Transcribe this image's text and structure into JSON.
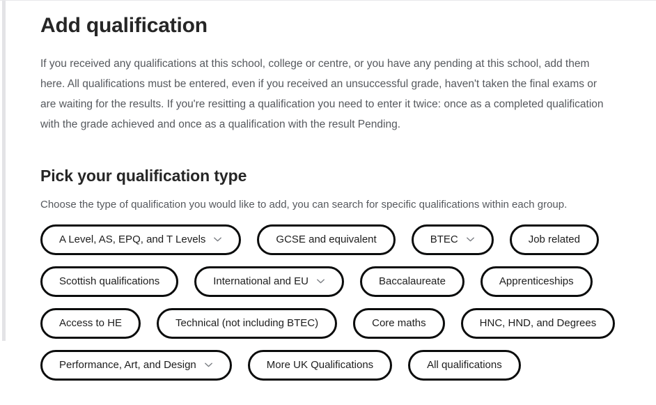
{
  "page": {
    "title": "Add qualification",
    "intro": "If you received any qualifications at this school, college or centre, or you have any pending at this school, add them here. All qualifications must be entered, even if you received an unsuccessful grade, haven't taken the final exams or are waiting for the results. If you're resitting a qualification you need to enter it twice: once as a completed qualification with the grade achieved and once as a qualification with the result Pending.",
    "section_title": "Pick your qualification type",
    "section_sub": "Choose the type of qualification you would like to add, you can search for specific qualifications within each group."
  },
  "colors": {
    "pill_border": "#0b0c0c",
    "text_primary": "#262626",
    "text_muted": "#55585d",
    "page_background": "#ffffff",
    "scroll_track": "#e3e3e6"
  },
  "icons": {
    "chevron": "chevron-down-icon"
  },
  "qualification_rows": [
    [
      {
        "label": "A Level, AS, EPQ, and T Levels",
        "has_chevron": true
      },
      {
        "label": "GCSE and equivalent",
        "has_chevron": false
      },
      {
        "label": "BTEC",
        "has_chevron": true
      },
      {
        "label": "Job related",
        "has_chevron": false
      }
    ],
    [
      {
        "label": "Scottish qualifications",
        "has_chevron": false
      },
      {
        "label": "International and EU",
        "has_chevron": true
      },
      {
        "label": "Baccalaureate",
        "has_chevron": false
      },
      {
        "label": "Apprenticeships",
        "has_chevron": false
      }
    ],
    [
      {
        "label": "Access to HE",
        "has_chevron": false
      },
      {
        "label": "Technical (not including BTEC)",
        "has_chevron": false
      },
      {
        "label": "Core maths",
        "has_chevron": false
      },
      {
        "label": "HNC, HND, and Degrees",
        "has_chevron": false
      }
    ],
    [
      {
        "label": "Performance, Art, and Design",
        "has_chevron": true
      },
      {
        "label": "More UK Qualifications",
        "has_chevron": false
      },
      {
        "label": "All qualifications",
        "has_chevron": false
      }
    ]
  ]
}
